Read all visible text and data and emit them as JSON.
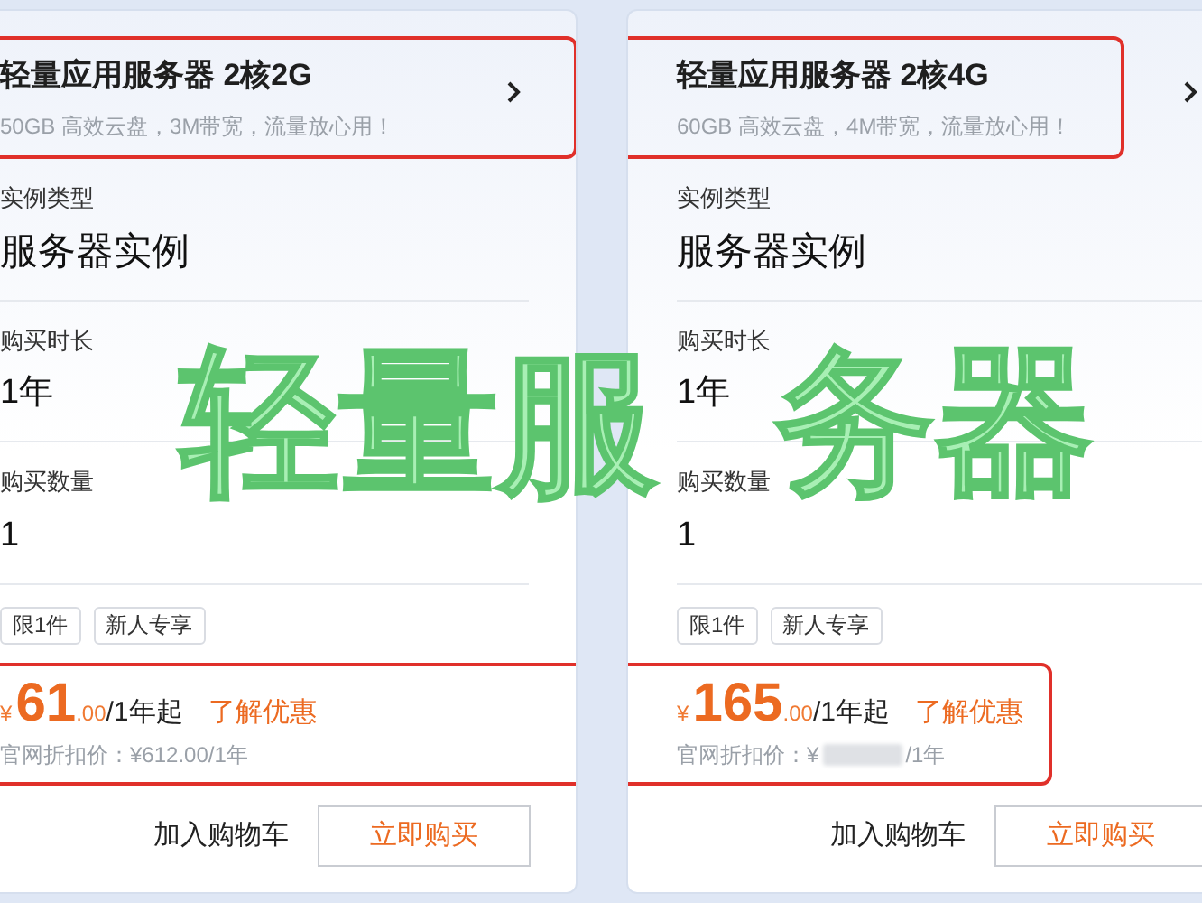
{
  "products": [
    {
      "title": "轻量应用服务器 2核2G",
      "subtitle": "50GB 高效云盘，3M带宽，流量放心用！",
      "title_marked": true,
      "fields": [
        {
          "label": "实例类型",
          "value": "服务器实例"
        },
        {
          "label": "购买时长",
          "value": "1年"
        },
        {
          "label": "购买数量",
          "value": "1"
        }
      ],
      "tags": [
        "限1件",
        "新人专享"
      ],
      "price": {
        "currency": "¥",
        "amount": "61",
        "decimals": ".00",
        "period": "/1年起",
        "link": "了解优惠",
        "marked": true,
        "original": [
          {
            "kind": "text",
            "text": "官网折扣价：¥612.00/1年"
          }
        ]
      },
      "cart_button": "加入购物车",
      "buy_button": "立即购买"
    },
    {
      "title": "轻量应用服务器 2核4G",
      "subtitle": "60GB 高效云盘，4M带宽，流量放心用！",
      "title_marked": true,
      "fields": [
        {
          "label": "实例类型",
          "value": "服务器实例"
        },
        {
          "label": "购买时长",
          "value": "1年"
        },
        {
          "label": "购买数量",
          "value": "1"
        }
      ],
      "tags": [
        "限1件",
        "新人专享"
      ],
      "price": {
        "currency": "¥",
        "amount": "165",
        "decimals": ".00",
        "period": "/1年起",
        "link": "了解优惠",
        "marked": true,
        "original": [
          {
            "kind": "text",
            "text": "官网折扣价：¥"
          },
          {
            "kind": "redacted"
          },
          {
            "kind": "text",
            "text": "/1年"
          }
        ]
      },
      "cart_button": "加入购物车",
      "buy_button": "立即购买"
    }
  ],
  "overlay_title": [
    "轻量服",
    "务器"
  ]
}
